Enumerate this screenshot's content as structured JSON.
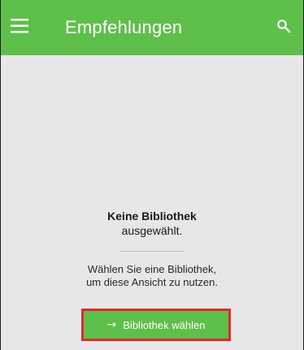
{
  "header": {
    "title": "Empfehlungen",
    "menu_icon": "hamburger-menu-icon",
    "search_icon": "search-icon"
  },
  "empty_state": {
    "heading": "Keine Bibliothek",
    "subheading": "ausgewählt.",
    "hint_line1": "Wählen Sie eine Bibliothek,",
    "hint_line2": "um diese Ansicht zu nutzen."
  },
  "action": {
    "arrow": "→",
    "label": "Bibliothek wählen"
  },
  "colors": {
    "appbar": "#5fbf4b",
    "content_bg": "#e7e7e7",
    "button": "#5fbf4b",
    "highlight_border": "#e5262c"
  }
}
